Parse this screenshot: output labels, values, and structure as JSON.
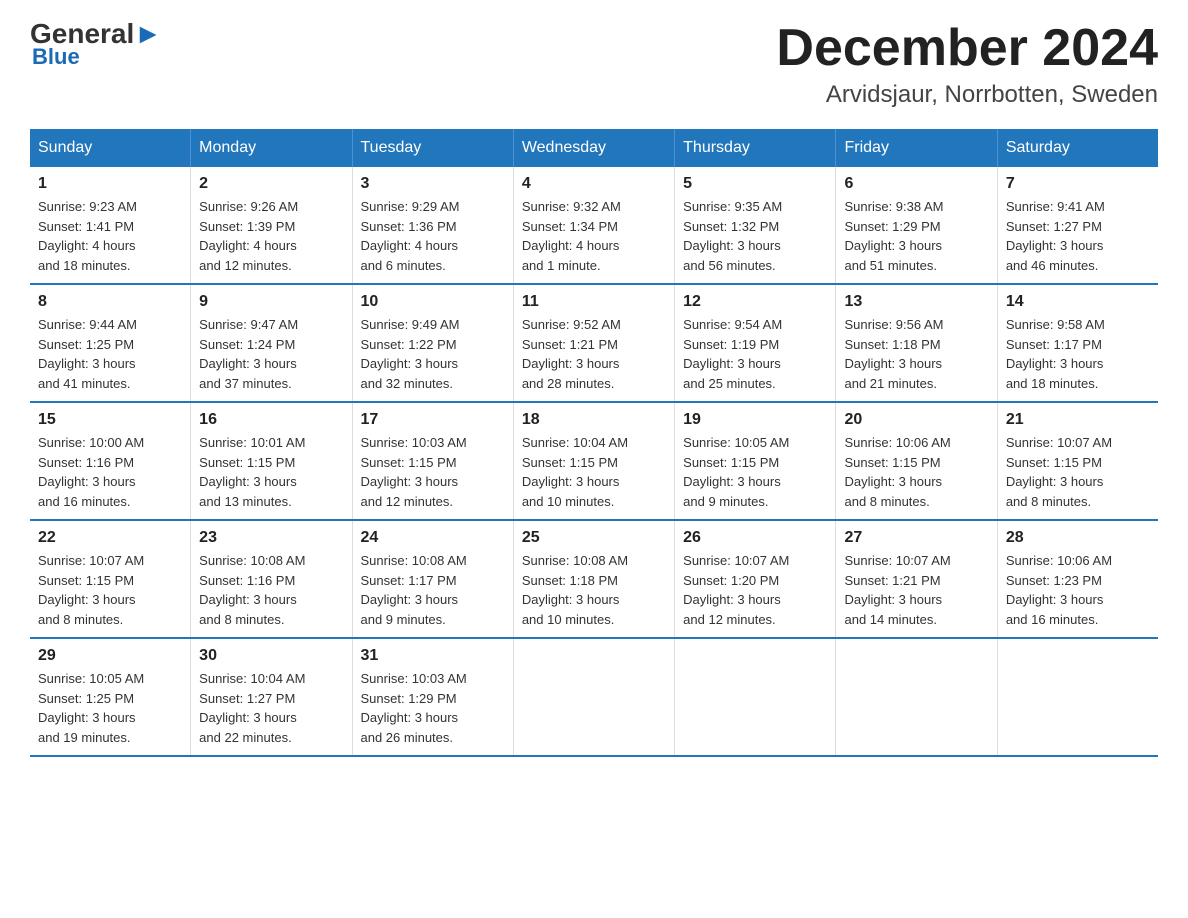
{
  "header": {
    "logo_general": "General",
    "logo_blue": "Blue",
    "month_title": "December 2024",
    "location": "Arvidsjaur, Norrbotten, Sweden"
  },
  "weekdays": [
    "Sunday",
    "Monday",
    "Tuesday",
    "Wednesday",
    "Thursday",
    "Friday",
    "Saturday"
  ],
  "weeks": [
    [
      {
        "day": "1",
        "info": "Sunrise: 9:23 AM\nSunset: 1:41 PM\nDaylight: 4 hours\nand 18 minutes."
      },
      {
        "day": "2",
        "info": "Sunrise: 9:26 AM\nSunset: 1:39 PM\nDaylight: 4 hours\nand 12 minutes."
      },
      {
        "day": "3",
        "info": "Sunrise: 9:29 AM\nSunset: 1:36 PM\nDaylight: 4 hours\nand 6 minutes."
      },
      {
        "day": "4",
        "info": "Sunrise: 9:32 AM\nSunset: 1:34 PM\nDaylight: 4 hours\nand 1 minute."
      },
      {
        "day": "5",
        "info": "Sunrise: 9:35 AM\nSunset: 1:32 PM\nDaylight: 3 hours\nand 56 minutes."
      },
      {
        "day": "6",
        "info": "Sunrise: 9:38 AM\nSunset: 1:29 PM\nDaylight: 3 hours\nand 51 minutes."
      },
      {
        "day": "7",
        "info": "Sunrise: 9:41 AM\nSunset: 1:27 PM\nDaylight: 3 hours\nand 46 minutes."
      }
    ],
    [
      {
        "day": "8",
        "info": "Sunrise: 9:44 AM\nSunset: 1:25 PM\nDaylight: 3 hours\nand 41 minutes."
      },
      {
        "day": "9",
        "info": "Sunrise: 9:47 AM\nSunset: 1:24 PM\nDaylight: 3 hours\nand 37 minutes."
      },
      {
        "day": "10",
        "info": "Sunrise: 9:49 AM\nSunset: 1:22 PM\nDaylight: 3 hours\nand 32 minutes."
      },
      {
        "day": "11",
        "info": "Sunrise: 9:52 AM\nSunset: 1:21 PM\nDaylight: 3 hours\nand 28 minutes."
      },
      {
        "day": "12",
        "info": "Sunrise: 9:54 AM\nSunset: 1:19 PM\nDaylight: 3 hours\nand 25 minutes."
      },
      {
        "day": "13",
        "info": "Sunrise: 9:56 AM\nSunset: 1:18 PM\nDaylight: 3 hours\nand 21 minutes."
      },
      {
        "day": "14",
        "info": "Sunrise: 9:58 AM\nSunset: 1:17 PM\nDaylight: 3 hours\nand 18 minutes."
      }
    ],
    [
      {
        "day": "15",
        "info": "Sunrise: 10:00 AM\nSunset: 1:16 PM\nDaylight: 3 hours\nand 16 minutes."
      },
      {
        "day": "16",
        "info": "Sunrise: 10:01 AM\nSunset: 1:15 PM\nDaylight: 3 hours\nand 13 minutes."
      },
      {
        "day": "17",
        "info": "Sunrise: 10:03 AM\nSunset: 1:15 PM\nDaylight: 3 hours\nand 12 minutes."
      },
      {
        "day": "18",
        "info": "Sunrise: 10:04 AM\nSunset: 1:15 PM\nDaylight: 3 hours\nand 10 minutes."
      },
      {
        "day": "19",
        "info": "Sunrise: 10:05 AM\nSunset: 1:15 PM\nDaylight: 3 hours\nand 9 minutes."
      },
      {
        "day": "20",
        "info": "Sunrise: 10:06 AM\nSunset: 1:15 PM\nDaylight: 3 hours\nand 8 minutes."
      },
      {
        "day": "21",
        "info": "Sunrise: 10:07 AM\nSunset: 1:15 PM\nDaylight: 3 hours\nand 8 minutes."
      }
    ],
    [
      {
        "day": "22",
        "info": "Sunrise: 10:07 AM\nSunset: 1:15 PM\nDaylight: 3 hours\nand 8 minutes."
      },
      {
        "day": "23",
        "info": "Sunrise: 10:08 AM\nSunset: 1:16 PM\nDaylight: 3 hours\nand 8 minutes."
      },
      {
        "day": "24",
        "info": "Sunrise: 10:08 AM\nSunset: 1:17 PM\nDaylight: 3 hours\nand 9 minutes."
      },
      {
        "day": "25",
        "info": "Sunrise: 10:08 AM\nSunset: 1:18 PM\nDaylight: 3 hours\nand 10 minutes."
      },
      {
        "day": "26",
        "info": "Sunrise: 10:07 AM\nSunset: 1:20 PM\nDaylight: 3 hours\nand 12 minutes."
      },
      {
        "day": "27",
        "info": "Sunrise: 10:07 AM\nSunset: 1:21 PM\nDaylight: 3 hours\nand 14 minutes."
      },
      {
        "day": "28",
        "info": "Sunrise: 10:06 AM\nSunset: 1:23 PM\nDaylight: 3 hours\nand 16 minutes."
      }
    ],
    [
      {
        "day": "29",
        "info": "Sunrise: 10:05 AM\nSunset: 1:25 PM\nDaylight: 3 hours\nand 19 minutes."
      },
      {
        "day": "30",
        "info": "Sunrise: 10:04 AM\nSunset: 1:27 PM\nDaylight: 3 hours\nand 22 minutes."
      },
      {
        "day": "31",
        "info": "Sunrise: 10:03 AM\nSunset: 1:29 PM\nDaylight: 3 hours\nand 26 minutes."
      },
      null,
      null,
      null,
      null
    ]
  ]
}
